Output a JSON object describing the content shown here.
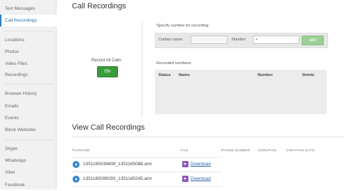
{
  "sidebar": {
    "items": [
      {
        "label": "Text Messages"
      },
      {
        "label": "Call Recordings"
      },
      {
        "label": "Locations"
      },
      {
        "label": "Photos"
      },
      {
        "label": "Video Files"
      },
      {
        "label": "Recordings"
      },
      {
        "label": "Browser History"
      },
      {
        "label": "Emails"
      },
      {
        "label": "Events"
      },
      {
        "label": "Block Websites"
      },
      {
        "label": "Skype"
      },
      {
        "label": "WhatsApp"
      },
      {
        "label": "Viber"
      },
      {
        "label": "Facebook"
      }
    ]
  },
  "page": {
    "title": "Call Recordings"
  },
  "record_all": {
    "label": "Record All Calls:",
    "button": "On"
  },
  "specify": {
    "label": "Specify number for recording:",
    "contact_label": "Contact name:",
    "contact_value": "",
    "number_label": "Number:",
    "number_value": "+",
    "add_label": "add"
  },
  "recorded": {
    "label": "Recorded numbers:",
    "columns": [
      "Status",
      "Name",
      "Number",
      "Delete"
    ]
  },
  "view": {
    "title": "View Call Recordings",
    "columns": [
      "FILENAME",
      "FILE",
      "PHONE NUMBER",
      "DURATION",
      "CREATION DATE"
    ],
    "rows": [
      {
        "filename": "1351165039608_1351165088.amr",
        "download": "Download"
      },
      {
        "filename": "1351165099293_1351165245.amr",
        "download": "Download"
      }
    ]
  }
}
